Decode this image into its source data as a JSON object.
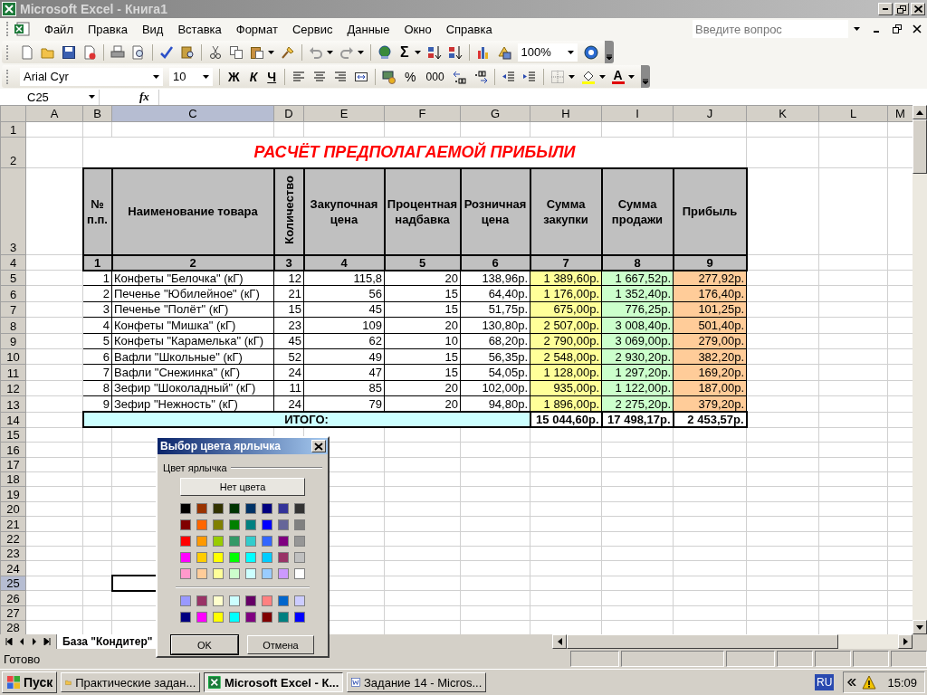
{
  "window": {
    "title": "Microsoft Excel - Книга1"
  },
  "menu": [
    "Файл",
    "Правка",
    "Вид",
    "Вставка",
    "Формат",
    "Сервис",
    "Данные",
    "Окно",
    "Справка"
  ],
  "help_search": {
    "placeholder": "Введите вопрос"
  },
  "toolbar": {
    "sum_symbol": "Σ",
    "zoom": "100%"
  },
  "format_bar": {
    "font": "Arial Cyr",
    "size": "10",
    "bold": "Ж",
    "italic": "К",
    "underline": "Ч",
    "percent": "%",
    "thousands": "000",
    "font_color_letter": "A"
  },
  "formula_bar": {
    "name_box": "C25",
    "fx": "fx"
  },
  "columns": [
    {
      "label": "A",
      "selected": false
    },
    {
      "label": "B",
      "selected": false
    },
    {
      "label": "C",
      "selected": true
    },
    {
      "label": "D",
      "selected": false
    },
    {
      "label": "E",
      "selected": false
    },
    {
      "label": "F",
      "selected": false
    },
    {
      "label": "G",
      "selected": false
    },
    {
      "label": "H",
      "selected": false
    },
    {
      "label": "I",
      "selected": false
    },
    {
      "label": "J",
      "selected": false
    },
    {
      "label": "K",
      "selected": false
    },
    {
      "label": "L",
      "selected": false
    },
    {
      "label": "M",
      "selected": false
    }
  ],
  "rows": [
    {
      "label": "1",
      "selected": false
    },
    {
      "label": "2",
      "selected": false
    },
    {
      "label": "3",
      "selected": false
    },
    {
      "label": "4",
      "selected": false
    },
    {
      "label": "5",
      "selected": false
    },
    {
      "label": "6",
      "selected": false
    },
    {
      "label": "7",
      "selected": false
    },
    {
      "label": "8",
      "selected": false
    },
    {
      "label": "9",
      "selected": false
    },
    {
      "label": "10",
      "selected": false
    },
    {
      "label": "11",
      "selected": false
    },
    {
      "label": "12",
      "selected": false
    },
    {
      "label": "13",
      "selected": false
    },
    {
      "label": "14",
      "selected": false
    },
    {
      "label": "15",
      "selected": false
    },
    {
      "label": "16",
      "selected": false
    },
    {
      "label": "17",
      "selected": false
    },
    {
      "label": "18",
      "selected": false
    },
    {
      "label": "19",
      "selected": false
    },
    {
      "label": "20",
      "selected": false
    },
    {
      "label": "21",
      "selected": false
    },
    {
      "label": "22",
      "selected": false
    },
    {
      "label": "23",
      "selected": false
    },
    {
      "label": "24",
      "selected": false
    },
    {
      "label": "25",
      "selected": true
    },
    {
      "label": "26",
      "selected": false
    },
    {
      "label": "27",
      "selected": false
    },
    {
      "label": "28",
      "selected": false
    }
  ],
  "sheet": {
    "title": "РАСЧЁТ ПРЕДПОЛАГАЕМОЙ ПРИБЫЛИ",
    "headers": [
      {
        "text": "№ п.п.",
        "vertical": false
      },
      {
        "text": "Наименование товара",
        "vertical": false
      },
      {
        "text": "Количество",
        "vertical": true
      },
      {
        "text": "Закупочная цена",
        "vertical": false
      },
      {
        "text": "Процентная надбавка",
        "vertical": false
      },
      {
        "text": "Розничная цена",
        "vertical": false
      },
      {
        "text": "Сумма закупки",
        "vertical": false
      },
      {
        "text": "Сумма продажи",
        "vertical": false
      },
      {
        "text": "Прибыль",
        "vertical": false
      }
    ],
    "header_numbers": [
      "1",
      "2",
      "3",
      "4",
      "5",
      "6",
      "7",
      "8",
      "9"
    ],
    "items": [
      [
        "1",
        "Конфеты \"Белочка\" (кГ)",
        "12",
        "115,8",
        "20",
        "138,96р.",
        "1 389,60р.",
        "1 667,52р.",
        "277,92р."
      ],
      [
        "2",
        "Печенье \"Юбилейное\" (кГ)",
        "21",
        "56",
        "15",
        "64,40р.",
        "1 176,00р.",
        "1 352,40р.",
        "176,40р."
      ],
      [
        "3",
        "Печенье \"Полёт\" (кГ)",
        "15",
        "45",
        "15",
        "51,75р.",
        "675,00р.",
        "776,25р.",
        "101,25р."
      ],
      [
        "4",
        "Конфеты \"Мишка\" (кГ)",
        "23",
        "109",
        "20",
        "130,80р.",
        "2 507,00р.",
        "3 008,40р.",
        "501,40р."
      ],
      [
        "5",
        "Конфеты \"Карамелька\" (кГ)",
        "45",
        "62",
        "10",
        "68,20р.",
        "2 790,00р.",
        "3 069,00р.",
        "279,00р."
      ],
      [
        "6",
        "Вафли \"Школьные\" (кГ)",
        "52",
        "49",
        "15",
        "56,35р.",
        "2 548,00р.",
        "2 930,20р.",
        "382,20р."
      ],
      [
        "7",
        "Вафли \"Снежинка\" (кГ)",
        "24",
        "47",
        "15",
        "54,05р.",
        "1 128,00р.",
        "1 297,20р.",
        "169,20р."
      ],
      [
        "8",
        "Зефир \"Шоколадный\" (кГ)",
        "11",
        "85",
        "20",
        "102,00р.",
        "935,00р.",
        "1 122,00р.",
        "187,00р."
      ],
      [
        "9",
        "Зефир \"Нежность\" (кГ)",
        "24",
        "79",
        "20",
        "94,80р.",
        "1 896,00р.",
        "2 275,20р.",
        "379,20р."
      ]
    ],
    "total_label": "ИТОГО:",
    "totals": [
      "15 044,60р.",
      "17 498,17р.",
      "2 453,57р."
    ]
  },
  "dialog": {
    "title": "Выбор цвета ярлычка",
    "group_label": "Цвет ярлычка",
    "no_color": "Нет цвета",
    "palette": [
      {
        "color": "#000000"
      },
      {
        "color": "#993300"
      },
      {
        "color": "#333300"
      },
      {
        "color": "#003300"
      },
      {
        "color": "#003366"
      },
      {
        "color": "#000080"
      },
      {
        "color": "#333399"
      },
      {
        "color": "#333333"
      },
      {
        "color": "#800000"
      },
      {
        "color": "#ff6600"
      },
      {
        "color": "#808000"
      },
      {
        "color": "#008000"
      },
      {
        "color": "#008080"
      },
      {
        "color": "#0000ff"
      },
      {
        "color": "#666699"
      },
      {
        "color": "#808080"
      },
      {
        "color": "#ff0000"
      },
      {
        "color": "#ff9900"
      },
      {
        "color": "#99cc00"
      },
      {
        "color": "#339966"
      },
      {
        "color": "#33cccc"
      },
      {
        "color": "#3366ff"
      },
      {
        "color": "#800080"
      },
      {
        "color": "#969696"
      },
      {
        "color": "#ff00ff"
      },
      {
        "color": "#ffcc00"
      },
      {
        "color": "#ffff00"
      },
      {
        "color": "#00ff00"
      },
      {
        "color": "#00ffff"
      },
      {
        "color": "#00ccff"
      },
      {
        "color": "#993366"
      },
      {
        "color": "#c0c0c0"
      },
      {
        "color": "#ff99cc"
      },
      {
        "color": "#ffcc99"
      },
      {
        "color": "#ffff99"
      },
      {
        "color": "#ccffcc"
      },
      {
        "color": "#ccffff"
      },
      {
        "color": "#99ccff"
      },
      {
        "color": "#cc99ff"
      },
      {
        "color": "#ffffff"
      }
    ],
    "extra_palette": [
      {
        "color": "#9999ff"
      },
      {
        "color": "#993366"
      },
      {
        "color": "#ffffcc"
      },
      {
        "color": "#ccffff"
      },
      {
        "color": "#660066"
      },
      {
        "color": "#ff8080"
      },
      {
        "color": "#0066cc"
      },
      {
        "color": "#ccccff"
      },
      {
        "color": "#000080"
      },
      {
        "color": "#ff00ff"
      },
      {
        "color": "#ffff00"
      },
      {
        "color": "#00ffff"
      },
      {
        "color": "#800080"
      },
      {
        "color": "#800000"
      },
      {
        "color": "#008080"
      },
      {
        "color": "#0000ff"
      }
    ],
    "ok": "OK",
    "cancel": "Отмена"
  },
  "sheet_tabs": [
    {
      "label": "База \"Кондитер\"",
      "selected": true
    }
  ],
  "status_bar": {
    "text": "Готово"
  },
  "taskbar": {
    "start": "Пуск",
    "tasks": [
      {
        "label": "Практические задан...",
        "selected": false,
        "kind": "folder"
      },
      {
        "label": "Microsoft Excel - К...",
        "selected": true,
        "kind": "excel"
      },
      {
        "label": "Задание 14 - Micros...",
        "selected": false,
        "kind": "word"
      }
    ],
    "language": "RU",
    "time": "15:09"
  }
}
